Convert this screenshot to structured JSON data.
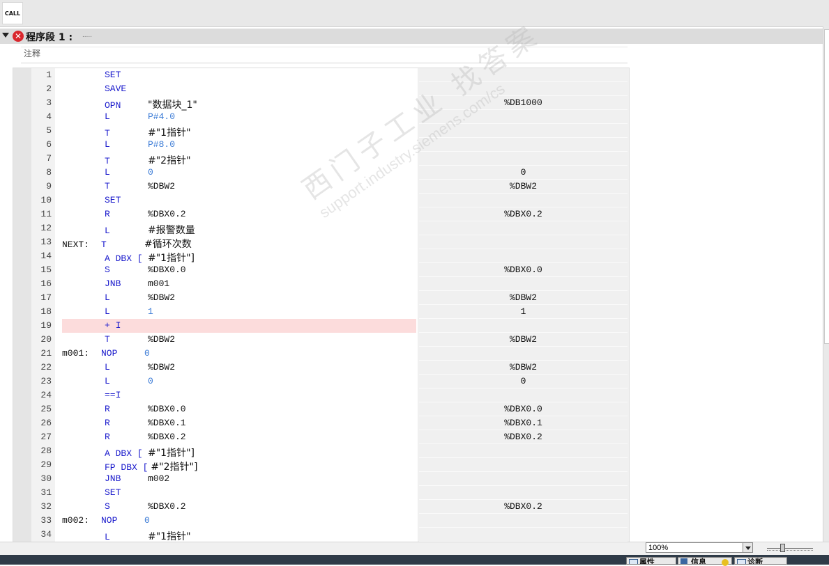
{
  "toolbar": {
    "call_label": "CALL"
  },
  "network": {
    "title": "程序段 1 :",
    "dots": ".....",
    "comment": "注释"
  },
  "watermark": {
    "line1": "西门子工业 找答案",
    "line2": "support.industry.siemens.com/cs"
  },
  "lines": [
    {
      "n": "1",
      "label": "",
      "op": "SET",
      "operand": "",
      "val": "",
      "err": false
    },
    {
      "n": "2",
      "label": "",
      "op": "SAVE",
      "operand": "",
      "val": "",
      "err": false
    },
    {
      "n": "3",
      "label": "",
      "op": "OPN",
      "operand": "\"数据块_1\"",
      "val": "%DB1000",
      "err": false
    },
    {
      "n": "4",
      "label": "",
      "op": "L",
      "operand": "P#4.0",
      "val": "",
      "err": false
    },
    {
      "n": "5",
      "label": "",
      "op": "T",
      "operand": "#\"1指针\"",
      "val": "",
      "err": false
    },
    {
      "n": "6",
      "label": "",
      "op": "L",
      "operand": "P#8.0",
      "val": "",
      "err": false
    },
    {
      "n": "7",
      "label": "",
      "op": "T",
      "operand": "#\"2指针\"",
      "val": "",
      "err": false
    },
    {
      "n": "8",
      "label": "",
      "op": "L",
      "operand": "0",
      "val": "0",
      "err": false
    },
    {
      "n": "9",
      "label": "",
      "op": "T",
      "operand": "%DBW2",
      "val": "%DBW2",
      "err": false
    },
    {
      "n": "10",
      "label": "",
      "op": "SET",
      "operand": "",
      "val": "",
      "err": false
    },
    {
      "n": "11",
      "label": "",
      "op": "R",
      "operand": "%DBX0.2",
      "val": "%DBX0.2",
      "err": false
    },
    {
      "n": "12",
      "label": "",
      "op": "L",
      "operand": "#报警数量",
      "val": "",
      "err": false
    },
    {
      "n": "13",
      "label": "NEXT:",
      "op": "T",
      "operand": "#循环次数",
      "val": "",
      "err": false
    },
    {
      "n": "14",
      "label": "",
      "op": "A DBX [",
      "operand": "#\"1指针\"]",
      "val": "",
      "err": false
    },
    {
      "n": "15",
      "label": "",
      "op": "S",
      "operand": "%DBX0.0",
      "val": "%DBX0.0",
      "err": false
    },
    {
      "n": "16",
      "label": "",
      "op": "JNB",
      "operand": "m001",
      "val": "",
      "err": false
    },
    {
      "n": "17",
      "label": "",
      "op": "L",
      "operand": "%DBW2",
      "val": "%DBW2",
      "err": false
    },
    {
      "n": "18",
      "label": "",
      "op": "L",
      "operand": "1",
      "val": "1",
      "err": false
    },
    {
      "n": "19",
      "label": "",
      "op": "+ I",
      "operand": "",
      "val": "",
      "err": true
    },
    {
      "n": "20",
      "label": "",
      "op": "T",
      "operand": "%DBW2",
      "val": "%DBW2",
      "err": false
    },
    {
      "n": "21",
      "label": "m001:",
      "op": "NOP",
      "operand": "0",
      "val": "",
      "err": false
    },
    {
      "n": "22",
      "label": "",
      "op": "L",
      "operand": "%DBW2",
      "val": "%DBW2",
      "err": false
    },
    {
      "n": "23",
      "label": "",
      "op": "L",
      "operand": "0",
      "val": "0",
      "err": false
    },
    {
      "n": "24",
      "label": "",
      "op": "==I",
      "operand": "",
      "val": "",
      "err": false
    },
    {
      "n": "25",
      "label": "",
      "op": "R",
      "operand": "%DBX0.0",
      "val": "%DBX0.0",
      "err": false
    },
    {
      "n": "26",
      "label": "",
      "op": "R",
      "operand": "%DBX0.1",
      "val": "%DBX0.1",
      "err": false
    },
    {
      "n": "27",
      "label": "",
      "op": "R",
      "operand": "%DBX0.2",
      "val": "%DBX0.2",
      "err": false
    },
    {
      "n": "28",
      "label": "",
      "op": "A DBX [",
      "operand": "#\"1指针\"]",
      "val": "",
      "err": false
    },
    {
      "n": "29",
      "label": "",
      "op": "FP DBX [",
      "operand": "#\"2指针\"]",
      "val": "",
      "err": false
    },
    {
      "n": "30",
      "label": "",
      "op": "JNB",
      "operand": "m002",
      "val": "",
      "err": false
    },
    {
      "n": "31",
      "label": "",
      "op": "SET",
      "operand": "",
      "val": "",
      "err": false
    },
    {
      "n": "32",
      "label": "",
      "op": "S",
      "operand": "%DBX0.2",
      "val": "%DBX0.2",
      "err": false
    },
    {
      "n": "33",
      "label": "m002:",
      "op": "NOP",
      "operand": "0",
      "val": "",
      "err": false
    },
    {
      "n": "34",
      "label": "",
      "op": "L",
      "operand": "#\"1指针\"",
      "val": "",
      "err": false
    }
  ],
  "status": {
    "zoom": "100%"
  },
  "bottom_tabs": [
    {
      "label": "属性"
    },
    {
      "label": "信息"
    },
    {
      "label": "诊断"
    }
  ]
}
